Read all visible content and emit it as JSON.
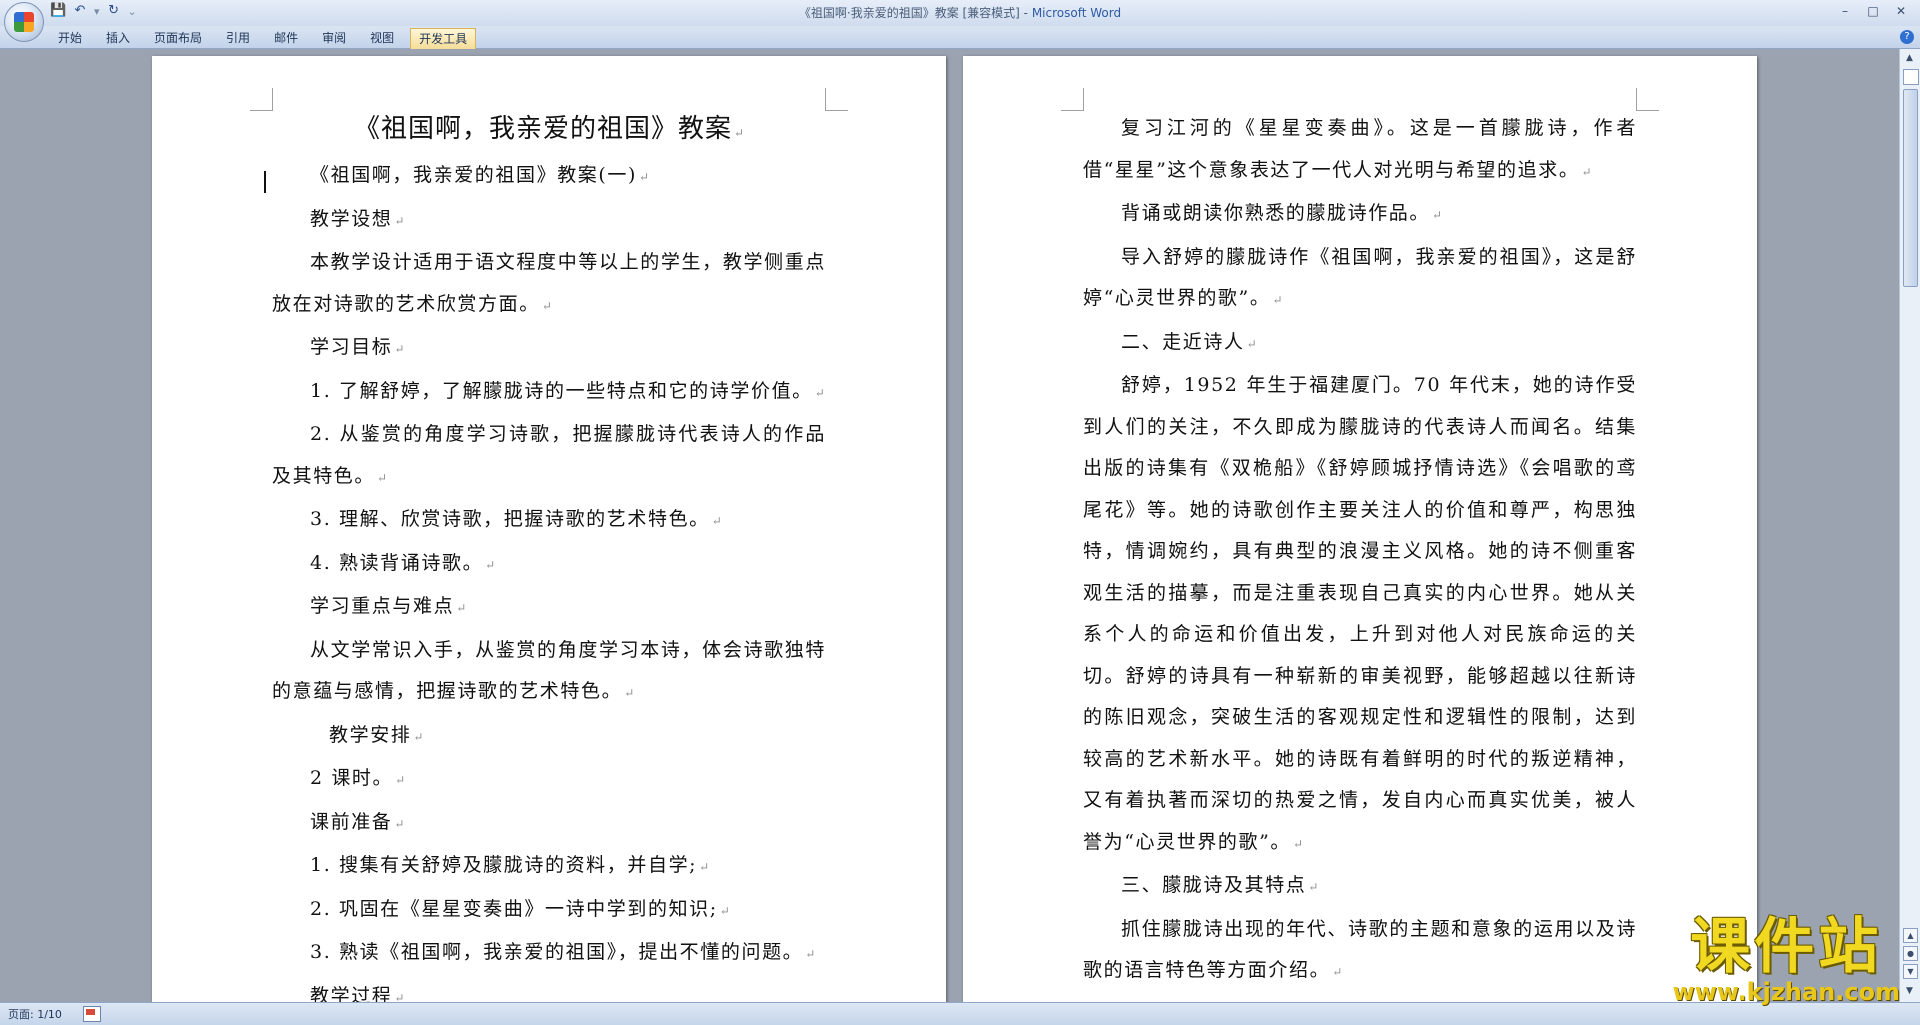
{
  "window": {
    "title": "《祖国啊·我亲爱的祖国》教案 [兼容模式] - ",
    "app_name": "Microsoft Word",
    "controls": [
      "–",
      "□",
      "✕"
    ]
  },
  "ribbon": {
    "tabs": [
      "开始",
      "插入",
      "页面布局",
      "引用",
      "邮件",
      "审阅",
      "视图",
      "开发工具"
    ],
    "active_tab_index": 7
  },
  "icons": {
    "office_button": "office-logo-icon",
    "save": "save-icon",
    "undo": "undo-icon",
    "redo": "redo-icon",
    "customize": "customize-qat-icon",
    "help": "help-icon"
  },
  "qat": {
    "separator": "▾",
    "customize": "⌄"
  },
  "help_label": "?",
  "left_page": {
    "title": "《祖国啊，我亲爱的祖国》教案",
    "paragraphs": [
      {
        "text": "《祖国啊，我亲爱的祖国》教案(一)",
        "indent": "normal"
      },
      {
        "text": "教学设想",
        "indent": "normal"
      },
      {
        "text": "本教学设计适用于语文程度中等以上的学生，教学侧重点放在对诗歌的艺术欣赏方面。",
        "indent": "normal"
      },
      {
        "text": "学习目标",
        "indent": "normal"
      },
      {
        "text": "1. 了解舒婷，了解朦胧诗的一些特点和它的诗学价值。",
        "indent": "normal"
      },
      {
        "text": "2. 从鉴赏的角度学习诗歌，把握朦胧诗代表诗人的作品及其特色。",
        "indent": "normal"
      },
      {
        "text": "3. 理解、欣赏诗歌，把握诗歌的艺术特色。",
        "indent": "normal"
      },
      {
        "text": "4. 熟读背诵诗歌。",
        "indent": "normal"
      },
      {
        "text": "学习重点与难点",
        "indent": "normal"
      },
      {
        "text": "从文学常识入手，从鉴赏的角度学习本诗，体会诗歌独特的意蕴与感情，把握诗歌的艺术特色。",
        "indent": "normal"
      },
      {
        "text": "教学安排",
        "indent": "more"
      },
      {
        "text": "2 课时。",
        "indent": "normal"
      },
      {
        "text": "课前准备",
        "indent": "normal"
      },
      {
        "text": "1. 搜集有关舒婷及朦胧诗的资料，并自学;",
        "indent": "normal"
      },
      {
        "text": "2. 巩固在《星星变奏曲》一诗中学到的知识;",
        "indent": "normal"
      },
      {
        "text": "3. 熟读《祖国啊，我亲爱的祖国》，提出不懂的问题。",
        "indent": "normal"
      },
      {
        "text": "教学过程",
        "indent": "normal"
      }
    ]
  },
  "right_page": {
    "paragraphs": [
      {
        "text": "复习江河的《星星变奏曲》。这是一首朦胧诗，作者借“星星”这个意象表达了一代人对光明与希望的追求。"
      },
      {
        "text": "背诵或朗读你熟悉的朦胧诗作品。"
      },
      {
        "text": "导入舒婷的朦胧诗作《祖国啊，我亲爱的祖国》，这是舒婷“心灵世界的歌”。"
      },
      {
        "text": "二、走近诗人"
      },
      {
        "text": "舒婷，1952 年生于福建厦门。70 年代末，她的诗作受到人们的关注，不久即成为朦胧诗的代表诗人而闻名。结集出版的诗集有《双桅船》《舒婷顾城抒情诗选》《会唱歌的鸢尾花》等。她的诗歌创作主要关注人的价值和尊严，构思独特，情调婉约，具有典型的浪漫主义风格。她的诗不侧重客观生活的描摹，而是注重表现自己真实的内心世界。她从关系个人的命运和价值出发，上升到对他人对民族命运的关切。舒婷的诗具有一种崭新的审美视野，能够超越以往新诗的陈旧观念，突破生活的客观规定性和逻辑性的限制，达到较高的艺术新水平。她的诗既有着鲜明的时代的叛逆精神，又有着执著而深切的热爱之情，发自内心而真实优美，被人誉为“心灵世界的歌”。"
      },
      {
        "text": "三、朦胧诗及其特点"
      },
      {
        "text": "抓住朦胧诗出现的年代、诗歌的主题和意象的运用以及诗歌的语言特色等方面介绍。"
      }
    ]
  },
  "paragraph_mark": "↵",
  "status": {
    "page": "页面: 1/10"
  },
  "watermark": {
    "main": "课件站",
    "url": "www.kjzhan.com"
  }
}
